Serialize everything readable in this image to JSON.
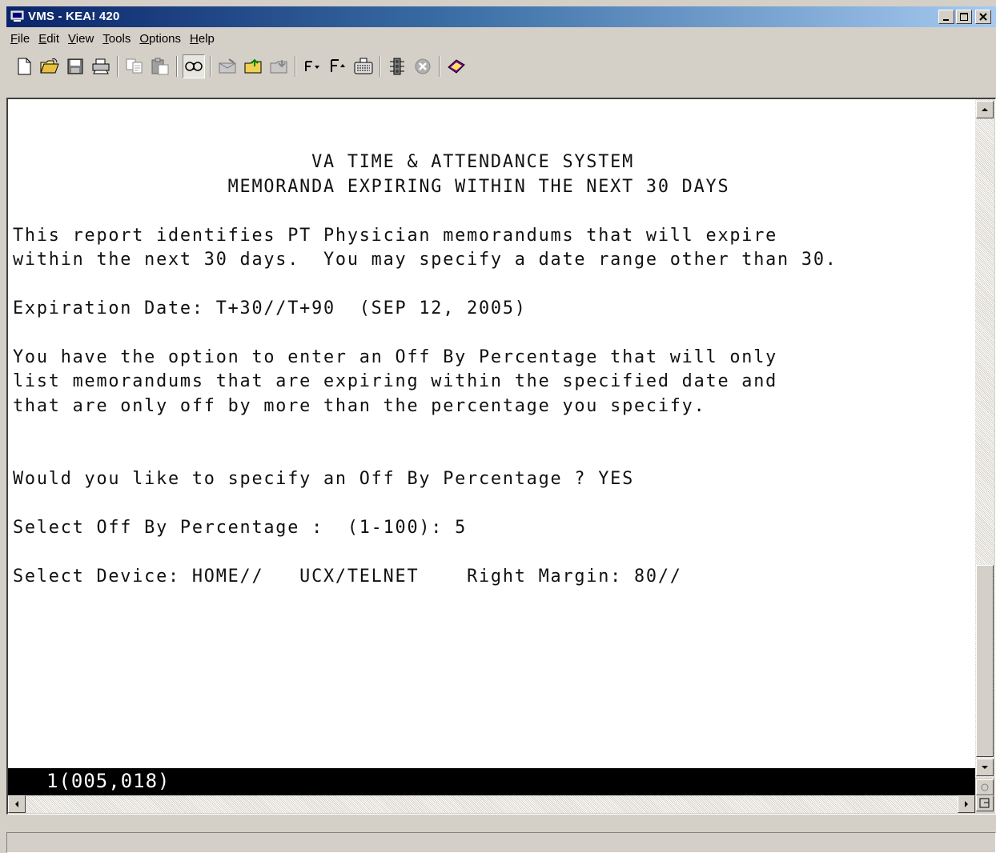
{
  "window": {
    "title": "VMS - KEA! 420"
  },
  "menu": [
    {
      "underline": "F",
      "rest": "ile"
    },
    {
      "underline": "E",
      "rest": "dit"
    },
    {
      "underline": "V",
      "rest": "iew"
    },
    {
      "underline": "T",
      "rest": "ools"
    },
    {
      "underline": "O",
      "rest": "ptions"
    },
    {
      "underline": "H",
      "rest": "elp"
    }
  ],
  "toolbar_icons": [
    "new-icon",
    "open-icon",
    "save-icon",
    "print-icon",
    "copy-icon",
    "paste-icon",
    "connect-icon",
    "mail-icon",
    "folder-send-icon",
    "folder-receive-icon",
    "font-down-icon",
    "font-up-icon",
    "keyboard-icon",
    "traffic-light-icon",
    "stop-icon",
    "help-book-icon"
  ],
  "terminal": {
    "lines": [
      "",
      "",
      "                         VA TIME & ATTENDANCE SYSTEM",
      "                  MEMORANDA EXPIRING WITHIN THE NEXT 30 DAYS",
      "",
      "This report identifies PT Physician memorandums that will expire",
      "within the next 30 days.  You may specify a date range other than 30.",
      "",
      "Expiration Date: T+30//T+90  (SEP 12, 2005)",
      "",
      "You have the option to enter an Off By Percentage that will only",
      "list memorandums that are expiring within the specified date and",
      "that are only off by more than the percentage you specify.",
      "",
      "",
      "Would you like to specify an Off By Percentage ? YES",
      "",
      "Select Off By Percentage :  (1-100): 5",
      "",
      "Select Device: HOME//   UCX/TELNET    Right Margin: 80//"
    ],
    "cursor_position": "1(005,018)"
  }
}
